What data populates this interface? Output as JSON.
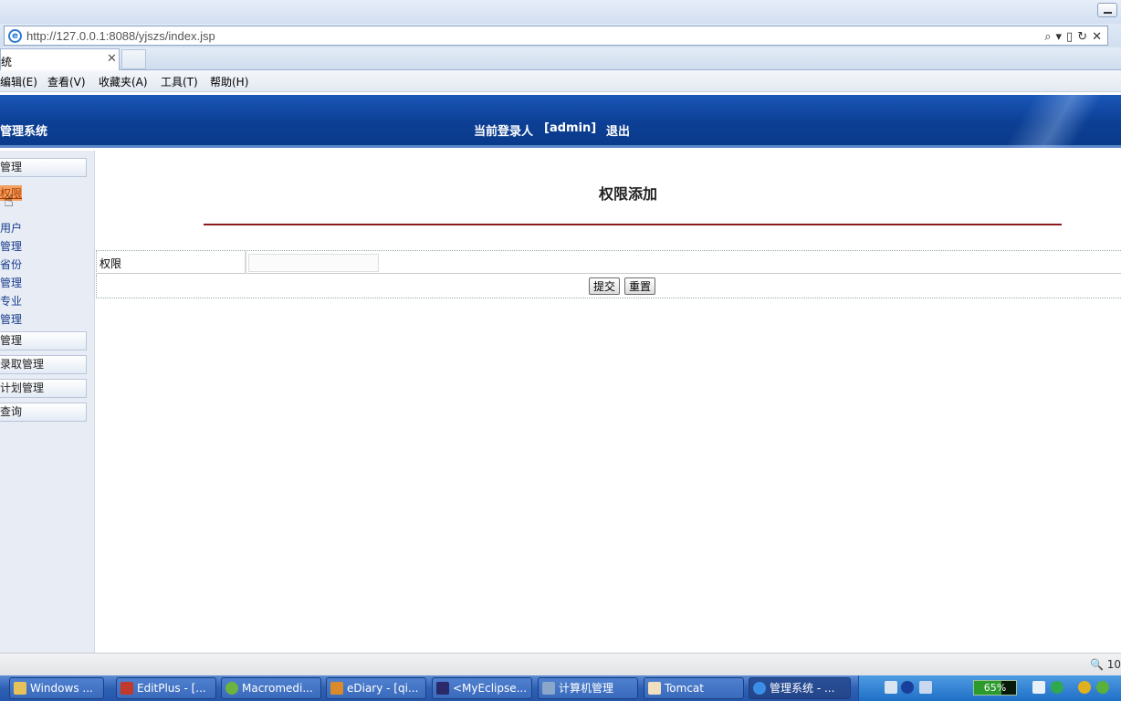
{
  "browser": {
    "url": "http://127.0.0.1:8088/yjszs/index.jsp",
    "tab_title": "统",
    "menus": [
      "编辑(E)",
      "查看(V)",
      "收藏夹(A)",
      "工具(T)",
      "帮助(H)"
    ],
    "zoom_text": "10"
  },
  "header": {
    "system_title": "管理系统",
    "login_label": "当前登录人",
    "login_user": "[admin]",
    "logout_label": "退出"
  },
  "sidebar": {
    "groups": [
      {
        "label": "管理"
      },
      {
        "label": "管理"
      },
      {
        "label": "录取管理"
      },
      {
        "label": "计划管理"
      },
      {
        "label": "查询"
      }
    ],
    "links": [
      "权限",
      "",
      "用户",
      "管理",
      "省份",
      "管理",
      "专业",
      "管理"
    ]
  },
  "form": {
    "title": "权限添加",
    "field_label": "权限",
    "field_value": "",
    "submit_label": "提交",
    "reset_label": "重置"
  },
  "taskbar": {
    "tasks": [
      "Windows ...",
      "EditPlus - [...",
      "Macromedi...",
      "eDiary - [qi...",
      "<MyEclipse...",
      "计算机管理",
      "Tomcat",
      "管理系统 - ..."
    ],
    "battery": "65%",
    "colors": {
      "taskbar": "#2e60b4",
      "tray": "#1e6fc7"
    }
  },
  "colors": {
    "header_blue": "#0c3f95",
    "title_rule": "#8b1a1a",
    "sidebar_bg": "#e8edf5"
  }
}
